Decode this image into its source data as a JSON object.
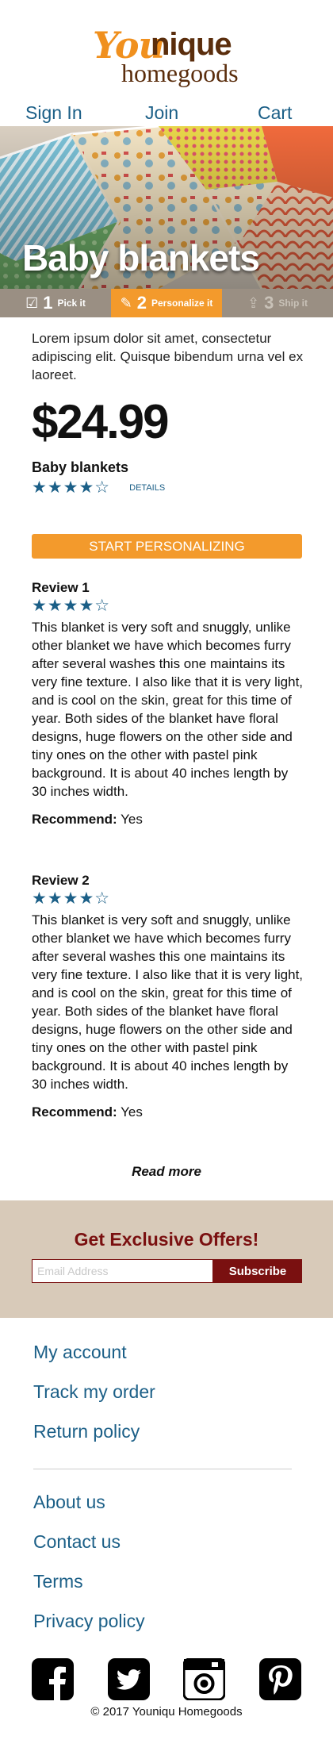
{
  "brand": {
    "logo_you": "You",
    "logo_nique": "nique",
    "logo_sub": "homegoods"
  },
  "nav": {
    "signin": "Sign In",
    "join": "Join",
    "cart": "Cart"
  },
  "hero": {
    "title": "Baby blankets"
  },
  "steps": [
    {
      "num": "1",
      "label": "Pick it",
      "icon": "check-icon",
      "state": "done"
    },
    {
      "num": "2",
      "label": "Personalize it",
      "icon": "edit-icon",
      "state": "active"
    },
    {
      "num": "3",
      "label": "Ship it",
      "icon": "share-icon",
      "state": "disabled"
    }
  ],
  "product": {
    "description": "Lorem ipsum dolor sit amet, consectetur adipiscing elit. Quisque bibendum urna vel ex laoreet.",
    "price": "$24.99",
    "name": "Baby blankets",
    "rating": 4,
    "rating_stars": "★★★★☆",
    "details_link": "DETAILS",
    "cta": "START PERSONALIZING"
  },
  "reviews": [
    {
      "title": "Review 1",
      "rating": 4,
      "stars": "★★★★☆",
      "text": "This blanket is very soft and snuggly, unlike other blanket we have which becomes furry after several washes this one maintains its very fine texture. I also like that it is very light, and is cool on the skin, great for this time of year. Both sides of the blanket have floral designs, huge flowers on the other side and tiny ones on the other with pastel pink background. It is about 40 inches length by 30 inches width.",
      "recommend_label": "Recommend:",
      "recommend_value": "Yes"
    },
    {
      "title": "Review 2",
      "rating": 4,
      "stars": "★★★★☆",
      "text": "This blanket is very soft and snuggly, unlike other blanket we have which becomes furry after several washes this one maintains its very fine texture. I also like that it is very light, and is cool on the skin, great for this time of year. Both sides of the blanket have floral designs, huge flowers on the other side and tiny ones on the other with pastel pink background. It is about 40 inches length by 30 inches width.",
      "recommend_label": "Recommend:",
      "recommend_value": "Yes"
    }
  ],
  "read_more": "Read more",
  "offers": {
    "title": "Get Exclusive Offers!",
    "email_placeholder": "Email Address",
    "subscribe": "Subscribe"
  },
  "footer": {
    "links_1": [
      "My account",
      "Track my order",
      "Return policy"
    ],
    "links_2": [
      "About us",
      "Contact us",
      "Terms",
      "Privacy policy"
    ],
    "social": [
      "facebook-icon",
      "twitter-icon",
      "instagram-icon",
      "pinterest-icon"
    ],
    "copyright": "© 2017 Youniqu Homegoods"
  },
  "colors": {
    "accent": "#f39a2c",
    "brand_brown": "#5a2d0c",
    "link_blue": "#1b5f87",
    "offers_bg": "#d8cab9",
    "maroon": "#7a1010"
  }
}
